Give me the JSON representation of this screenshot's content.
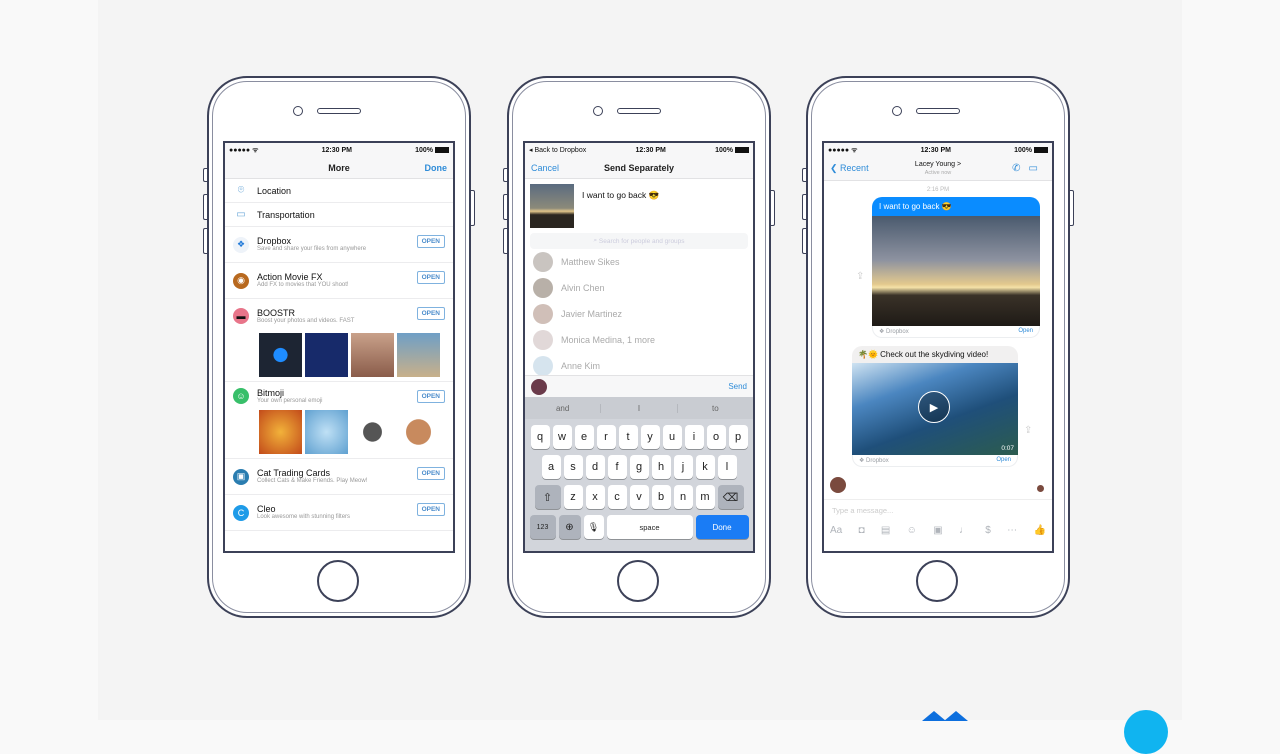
{
  "status": {
    "signal": "●●●●● ᯤ",
    "time": "12:30 PM",
    "battery": "100%"
  },
  "phone1": {
    "title": "More",
    "done": "Done",
    "rows": [
      {
        "label": "Location",
        "icon": "location-pin-icon"
      },
      {
        "label": "Transportation",
        "icon": "car-icon"
      }
    ],
    "apps": [
      {
        "name": "Dropbox",
        "desc": "Save and share your files from anywhere",
        "open": "OPEN",
        "color": "#1e78d8"
      },
      {
        "name": "Action Movie FX",
        "desc": "Add FX to movies that YOU shoot!",
        "open": "OPEN",
        "color": "#b8691f"
      },
      {
        "name": "BOOSTR",
        "desc": "Boost your photos and videos. FAST",
        "open": "OPEN",
        "color": "#e8758a"
      },
      {
        "name": "Bitmoji",
        "desc": "Your own personal emoji",
        "open": "OPEN",
        "color": "#38bf6a"
      },
      {
        "name": "Cat Trading Cards",
        "desc": "Collect Cats & Make Friends. Play Meow!",
        "open": "OPEN",
        "color": "#2a7db0"
      },
      {
        "name": "Cleo",
        "desc": "Look awesome with stunning filters",
        "open": "OPEN",
        "color": "#1e9be8"
      }
    ]
  },
  "phone2": {
    "back": "◂ Back to Dropbox",
    "cancel": "Cancel",
    "title": "Send Separately",
    "message": "I want to go back 😎",
    "search_placeholder": "Search for people and groups",
    "contacts": [
      "Matthew Sikes",
      "Alvin Chen",
      "Javier Martinez",
      "Monica Medina, 1 more",
      "Anne Kim"
    ],
    "send": "Send",
    "predictions": [
      "and",
      "I",
      "to"
    ],
    "keys_row1": [
      "q",
      "w",
      "e",
      "r",
      "t",
      "y",
      "u",
      "i",
      "o",
      "p"
    ],
    "keys_row2": [
      "a",
      "s",
      "d",
      "f",
      "g",
      "h",
      "j",
      "k",
      "l"
    ],
    "keys_row3": [
      "z",
      "x",
      "c",
      "v",
      "b",
      "n",
      "m"
    ],
    "key_123": "123",
    "key_space": "space",
    "key_done": "Done"
  },
  "phone3": {
    "back": "Recent",
    "contact_name": "Lacey Young >",
    "contact_status": "Active now",
    "timestamp": "2:16 PM",
    "msg1": "I want to go back 😎",
    "msg1_source": "Dropbox",
    "msg1_open": "Open",
    "msg2": "🌴🌞 Check out the skydiving video!",
    "msg2_duration": "0:07",
    "msg2_source": "Dropbox",
    "msg2_open": "Open",
    "input_placeholder": "Type a message...",
    "aa": "Aa"
  },
  "colors": {
    "messenger_blue": "#0a8cff",
    "ios_blue": "#2f8cd8",
    "keyboard_done": "#1a7cf5"
  }
}
